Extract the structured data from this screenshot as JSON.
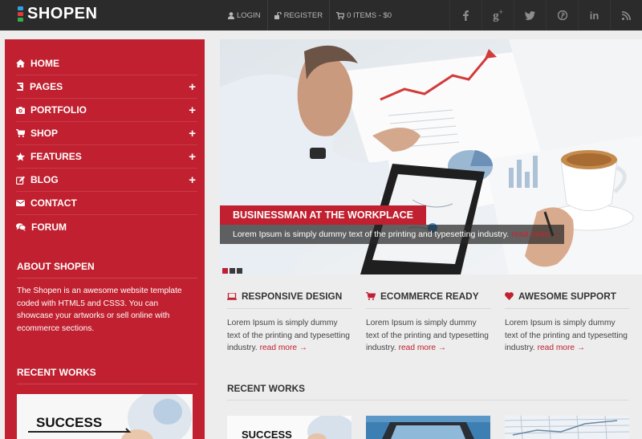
{
  "brand": {
    "name": "SHOPEN",
    "mark_colors": [
      "#2aa5e0",
      "#e23b3b",
      "#31b14a"
    ]
  },
  "topnav": {
    "login": "LOGIN",
    "register": "REGISTER",
    "cart": "0 ITEMS - $0"
  },
  "social": [
    "facebook-icon",
    "google-plus-icon",
    "twitter-icon",
    "pinterest-icon",
    "linkedin-icon",
    "rss-icon"
  ],
  "sidebar": {
    "menu": [
      {
        "label": "HOME",
        "icon": "home-icon",
        "expandable": false
      },
      {
        "label": "PAGES",
        "icon": "book-icon",
        "expandable": true
      },
      {
        "label": "PORTFOLIO",
        "icon": "camera-icon",
        "expandable": true
      },
      {
        "label": "SHOP",
        "icon": "cart-icon",
        "expandable": true
      },
      {
        "label": "FEATURES",
        "icon": "star-icon",
        "expandable": true
      },
      {
        "label": "BLOG",
        "icon": "edit-icon",
        "expandable": true
      },
      {
        "label": "CONTACT",
        "icon": "envelope-icon",
        "expandable": false
      },
      {
        "label": "FORUM",
        "icon": "comments-icon",
        "expandable": false
      }
    ],
    "plus": "+",
    "about_title": "ABOUT SHOPEN",
    "about_text": "The Shopen is an awesome website template coded with HTML5 and CSS3. You can showcase your artworks or sell online with ecommerce sections.",
    "recent_title": "RECENT WORKS",
    "thumb_text": "SUCCESS"
  },
  "slider": {
    "caption_title": "BUSINESSMAN AT THE WORKPLACE",
    "caption_text": "Lorem Ipsum is simply dummy text of the printing and typesetting industry.",
    "read_more": "read more →",
    "slide_count": 3,
    "active_slide": 1
  },
  "features": [
    {
      "title": "RESPONSIVE DESIGN",
      "icon": "laptop-icon",
      "text": "Lorem Ipsum is simply dummy text of the printing and typesetting industry.",
      "link": "read more →"
    },
    {
      "title": "ECOMMERCE READY",
      "icon": "cart-icon",
      "text": "Lorem Ipsum is simply dummy text of the printing and typesetting industry.",
      "link": "read more →"
    },
    {
      "title": "AWESOME SUPPORT",
      "icon": "heart-icon",
      "text": "Lorem Ipsum is simply dummy text of the printing and typesetting industry.",
      "link": "read more →"
    }
  ],
  "recent_works": {
    "title": "RECENT WORKS",
    "thumb_text": "SUCCESS"
  },
  "colors": {
    "accent": "#c0202f",
    "topbar": "#2b2b2b",
    "background": "#ededed"
  }
}
